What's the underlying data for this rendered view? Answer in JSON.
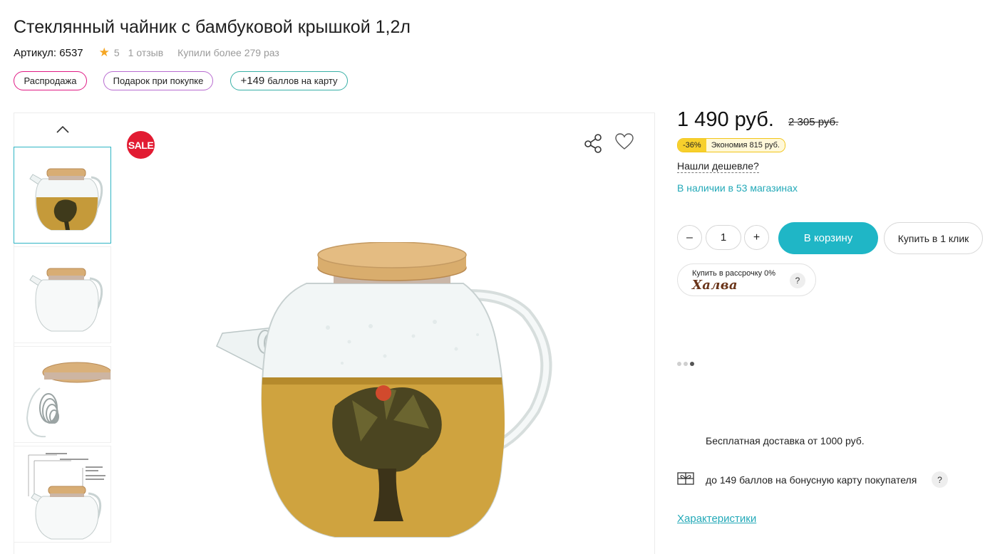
{
  "product": {
    "title": "Стеклянный чайник с бамбуковой крышкой 1,2л",
    "sku_label": "Артикул: 6537",
    "rating": "5",
    "reviews": "1 отзыв",
    "purchases": "Купили более 279 раз"
  },
  "tags": {
    "sale": "Распродажа",
    "gift": "Подарок при покупке",
    "points_big": "+149",
    "points_rest": "баллов на карту"
  },
  "gallery": {
    "sale_badge": "SALE"
  },
  "price": {
    "current": "1 490 руб.",
    "old": "2 305 руб.",
    "discount_pct": "-36%",
    "savings": "Экономия 815 руб."
  },
  "cheaper_link": "Нашли дешевле?",
  "stock": "В наличии в 53 магазинах",
  "quantity": {
    "minus": "–",
    "value": "1",
    "plus": "+"
  },
  "buttons": {
    "cart": "В корзину",
    "one_click": "Купить в 1 клик"
  },
  "halva": {
    "small_text": "Купить в рассрочку 0%",
    "logo": "Халва",
    "help": "?"
  },
  "info": {
    "delivery": "Бесплатная доставка от 1000 руб.",
    "bonus": "до 149 баллов на бонусную карту покупателя",
    "bonus_help": "?"
  },
  "characteristics_link": "Характеристики",
  "colors": {
    "accent": "#1fb6c6",
    "sale_red": "#e21b32",
    "pink_border": "#e01a84",
    "discount_yellow": "#f7d02c"
  }
}
